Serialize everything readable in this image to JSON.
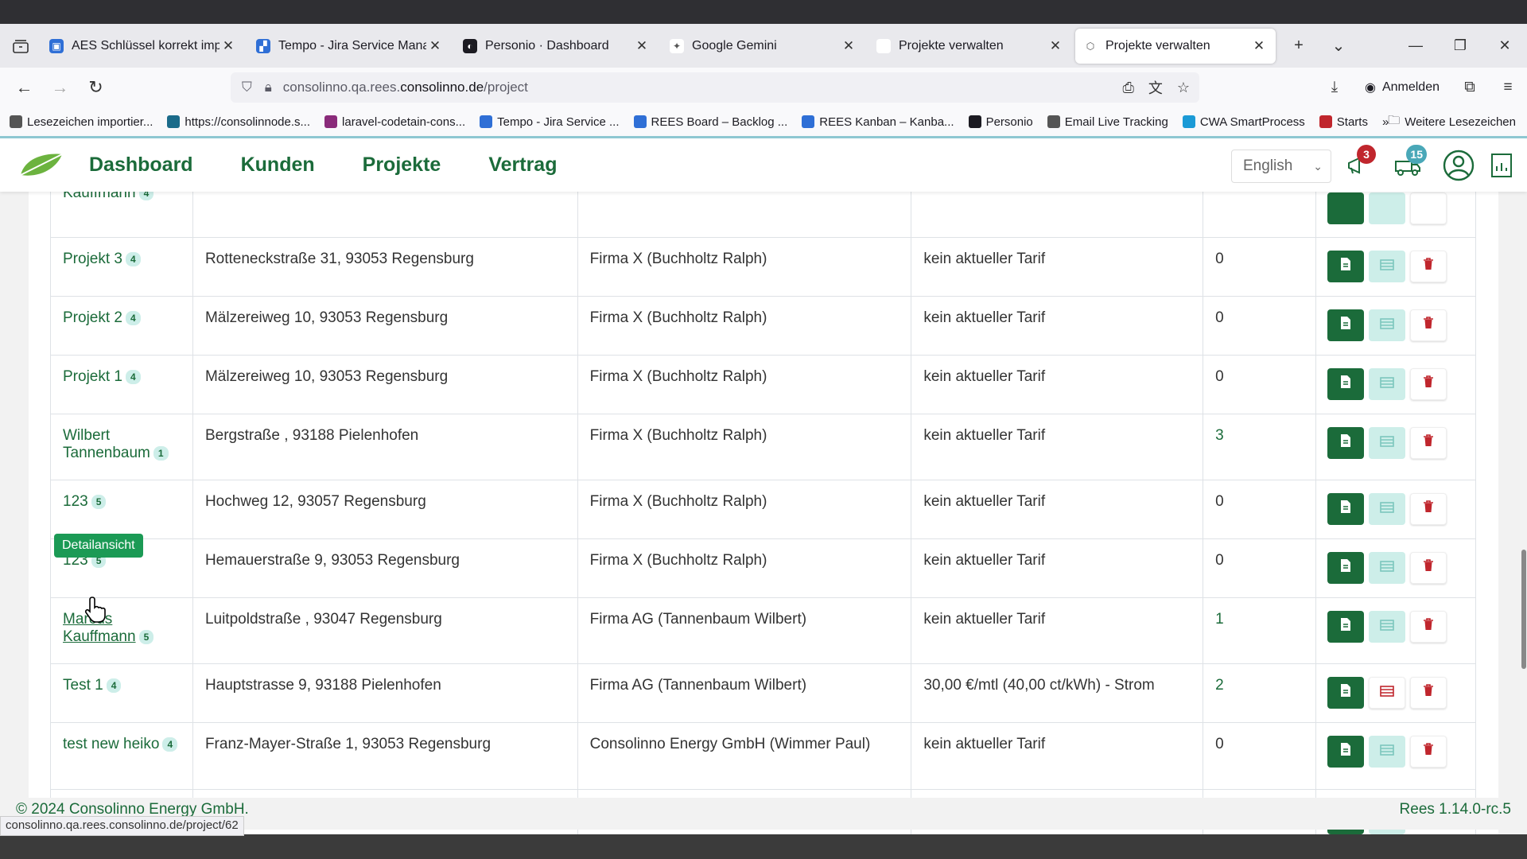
{
  "browser": {
    "tabs": [
      {
        "title": "AES Schlüssel korrekt impor",
        "fav_color": "#2f6fd6",
        "fav_glyph": "▣"
      },
      {
        "title": "Tempo - Jira Service Manag",
        "fav_color": "#2f6fd6",
        "fav_glyph": "▞"
      },
      {
        "title": "Personio · Dashboard",
        "fav_color": "#1c1b22",
        "fav_glyph": "◐"
      },
      {
        "title": "Google Gemini",
        "fav_color": "#ffffff",
        "fav_glyph": "✦"
      },
      {
        "title": "Projekte verwalten",
        "fav_color": "#ffffff",
        "fav_glyph": ""
      },
      {
        "title": "Projekte verwalten",
        "fav_color": "#ffffff",
        "fav_glyph": "⬡"
      }
    ],
    "url_prefix": "consolinno.qa.rees.",
    "url_domain": "consolinno.de",
    "url_path": "/project",
    "signin_label": "Anmelden",
    "bookmarks": [
      {
        "label": "Lesezeichen importier...",
        "color": "#555"
      },
      {
        "label": "https://consolinnode.s...",
        "color": "#1b6b8a"
      },
      {
        "label": "laravel-codetain-cons...",
        "color": "#8a2b7a"
      },
      {
        "label": "Tempo - Jira Service ...",
        "color": "#2f6fd6"
      },
      {
        "label": "REES Board – Backlog ...",
        "color": "#2f6fd6"
      },
      {
        "label": "REES Kanban – Kanba...",
        "color": "#2f6fd6"
      },
      {
        "label": "Personio",
        "color": "#1c1b22"
      },
      {
        "label": "Email Live Tracking",
        "color": "#555"
      },
      {
        "label": "CWA SmartProcess",
        "color": "#1b9ad6"
      },
      {
        "label": "Starts",
        "color": "#c0262d"
      }
    ],
    "bookmarks_more": "Weitere Lesezeichen",
    "status_url": "consolinno.qa.rees.consolinno.de/project/62"
  },
  "app": {
    "menu": [
      "Dashboard",
      "Kunden",
      "Projekte",
      "Vertrag"
    ],
    "language": "English",
    "notifications_count": "3",
    "notifications_badge_color": "#c0262d",
    "messages_count": "15",
    "messages_badge_color": "#4aa8b8",
    "tooltip": "Detailansicht",
    "partial_top_row": {
      "name": "Kauffmann",
      "count": "4"
    },
    "rows": [
      {
        "name": "Projekt 3",
        "count": "4",
        "address": "Rotteneckstraße 31, 93053 Regensburg",
        "customer": "Firma X (Buchholtz Ralph)",
        "tariff": "kein aktueller Tarif",
        "num": "0"
      },
      {
        "name": "Projekt 2",
        "count": "4",
        "address": "Mälzereiweg 10, 93053 Regensburg",
        "customer": "Firma X (Buchholtz Ralph)",
        "tariff": "kein aktueller Tarif",
        "num": "0"
      },
      {
        "name": "Projekt 1",
        "count": "4",
        "address": "Mälzereiweg 10, 93053 Regensburg",
        "customer": "Firma X (Buchholtz Ralph)",
        "tariff": "kein aktueller Tarif",
        "num": "0"
      },
      {
        "name": "Wilbert Tannenbaum",
        "count": "1",
        "address": "Bergstraße , 93188 Pielenhofen",
        "customer": "Firma X (Buchholtz Ralph)",
        "tariff": "kein aktueller Tarif",
        "num": "3"
      },
      {
        "name": "123",
        "count": "5",
        "address": "Hochweg 12, 93057 Regensburg",
        "customer": "Firma X (Buchholtz Ralph)",
        "tariff": "kein aktueller Tarif",
        "num": "0"
      },
      {
        "name": "123",
        "count": "5",
        "address": "Hemauerstraße 9, 93053 Regensburg",
        "customer": "Firma X (Buchholtz Ralph)",
        "tariff": "kein aktueller Tarif",
        "num": "0"
      },
      {
        "name": "Marcus Kauffmann",
        "count": "5",
        "address": "Luitpoldstraße , 93047 Regensburg",
        "customer": "Firma AG (Tannenbaum Wilbert)",
        "tariff": "kein aktueller Tarif",
        "num": "1"
      },
      {
        "name": "Test 1",
        "count": "4",
        "address": "Hauptstrasse 9, 93188 Pielenhofen",
        "customer": "Firma AG (Tannenbaum Wilbert)",
        "tariff": "30,00 €/mtl (40,00 ct/kWh) - Strom",
        "num": "2"
      },
      {
        "name": "test new heiko",
        "count": "4",
        "address": "Franz-Mayer-Straße 1, 93053 Regensburg",
        "customer": "Consolinno Energy GmbH (Wimmer Paul)",
        "tariff": "kein aktueller Tarif",
        "num": "0"
      }
    ],
    "footer_left": "© 2024 Consolinno Energy GmbH.",
    "footer_right": "Rees 1.14.0-rc.5"
  }
}
